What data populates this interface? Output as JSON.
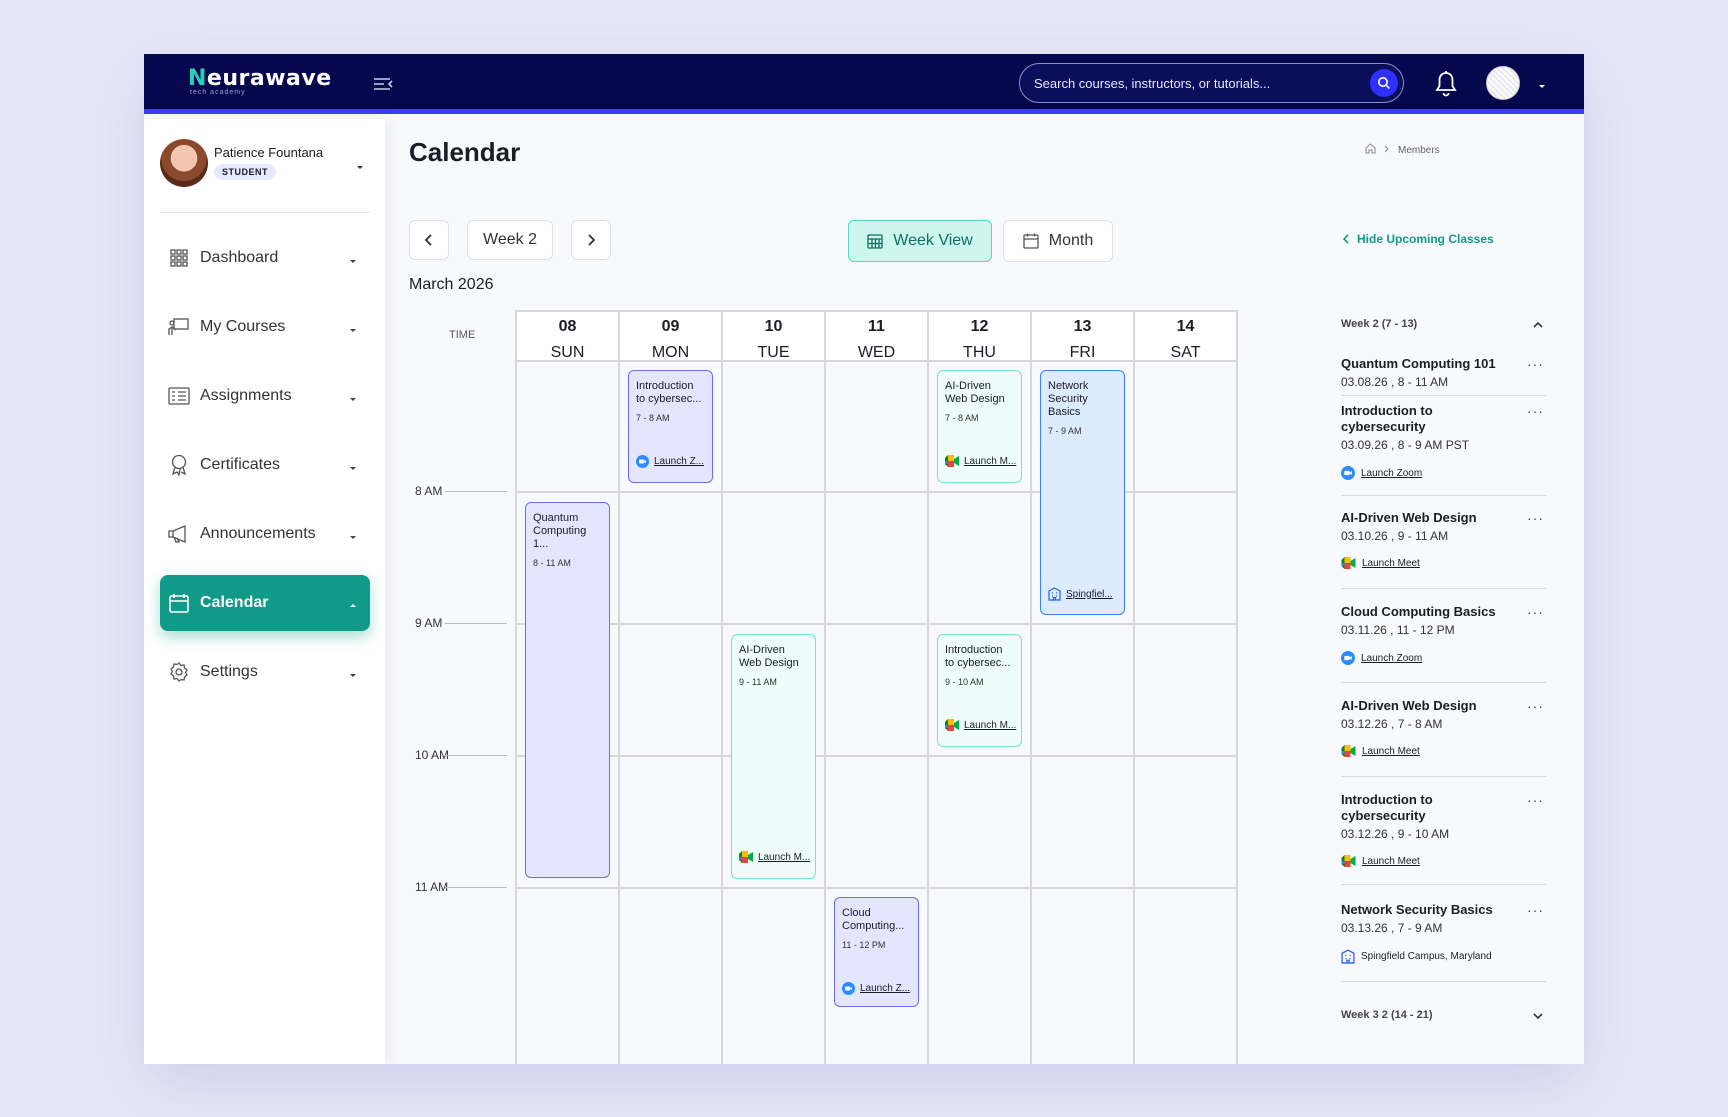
{
  "brand": {
    "name_first": "N",
    "name_rest": "eurawave",
    "tagline": "tech academy"
  },
  "search": {
    "placeholder": "Search courses, instructors, or tutorials..."
  },
  "user": {
    "name": "Patience Fountana",
    "role": "STUDENT"
  },
  "nav": [
    {
      "label": "Dashboard",
      "icon": "grid-icon"
    },
    {
      "label": "My Courses",
      "icon": "teacher-board-icon"
    },
    {
      "label": "Assignments",
      "icon": "assignment-list-icon"
    },
    {
      "label": "Certificates",
      "icon": "award-ribbon-icon"
    },
    {
      "label": "Announcements",
      "icon": "megaphone-icon"
    },
    {
      "label": "Calendar",
      "icon": "calendar-icon",
      "active": true
    },
    {
      "label": "Settings",
      "icon": "gear-icon"
    }
  ],
  "page": {
    "title": "Calendar",
    "breadcrumb": "Members"
  },
  "toolbar": {
    "week": "Week 2",
    "week_view": "Week View",
    "month": "Month",
    "hide_upcoming": "Hide Upcoming Classes"
  },
  "calendar": {
    "month_label": "March 2026",
    "time_header": "TIME",
    "ticks": [
      "8 AM",
      "9 AM",
      "10 AM",
      "11 AM"
    ],
    "days": [
      {
        "num": "08",
        "name": "SUN"
      },
      {
        "num": "09",
        "name": "MON"
      },
      {
        "num": "10",
        "name": "TUE"
      },
      {
        "num": "11",
        "name": "WED"
      },
      {
        "num": "12",
        "name": "THU"
      },
      {
        "num": "13",
        "name": "FRI"
      },
      {
        "num": "14",
        "name": "SAT"
      }
    ],
    "events": [
      {
        "title": "Quantum Computing 1...",
        "time": "8 - 11 AM"
      },
      {
        "title": "Introduction to cybersec...",
        "time": "7 - 8 AM",
        "link": "Launch Z..."
      },
      {
        "title": "AI-Driven Web Design",
        "time": "9 - 11 AM",
        "link": "Launch M..."
      },
      {
        "title": "Cloud Computing...",
        "time": "11 - 12 PM",
        "link": "Launch Z..."
      },
      {
        "title": "AI-Driven Web Design",
        "time": "7 - 8 AM",
        "link": "Launch M..."
      },
      {
        "title": "Introduction to cybersec...",
        "time": "9 - 10 AM",
        "link": "Launch M..."
      },
      {
        "title": "Network Security Basics",
        "time": "7 - 9 AM",
        "link": "Spingfiel..."
      }
    ]
  },
  "upcoming": {
    "week2_label": "Week 2 (7 - 13)",
    "week3_label": "Week 3 2 (14 - 21)",
    "more": "···",
    "items": [
      {
        "title": "Quantum Computing 101",
        "date": "03.08.26 , 8 - 11 AM",
        "link": ""
      },
      {
        "title": "Introduction to cybersecurity",
        "date": "03.09.26 , 8 - 9 AM PST",
        "link": "Launch Zoom"
      },
      {
        "title": "AI-Driven Web Design",
        "date": "03.10.26 , 9 - 11 AM",
        "link": "Launch Meet"
      },
      {
        "title": "Cloud Computing Basics",
        "date": "03.11.26 , 11 - 12 PM",
        "link": "Launch Zoom"
      },
      {
        "title": "AI-Driven Web Design",
        "date": "03.12.26 , 7 - 8 AM",
        "link": "Launch Meet"
      },
      {
        "title": "Introduction to cybersecurity",
        "date": "03.12.26 , 9 - 10 AM",
        "link": "Launch Meet"
      },
      {
        "title": "Network Security Basics",
        "date": "03.13.26 , 7 - 9 AM",
        "link": "Spingfield Campus, Maryland"
      }
    ]
  }
}
